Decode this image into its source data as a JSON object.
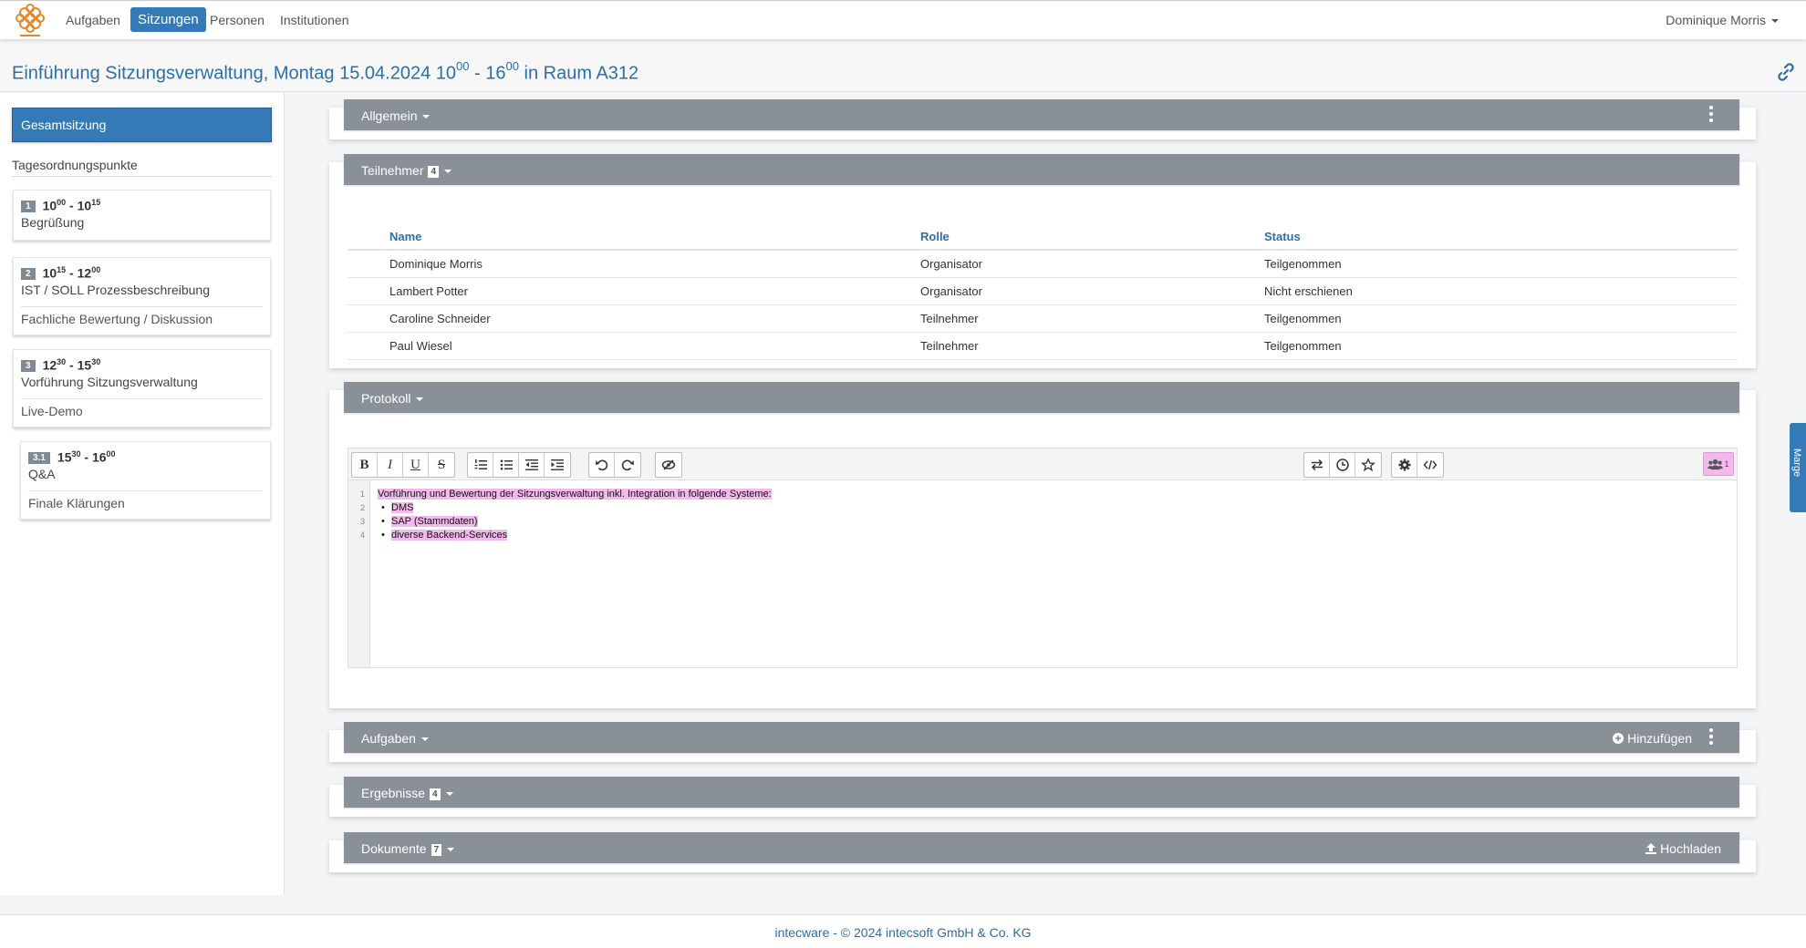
{
  "nav": {
    "items": [
      {
        "label": "Aufgaben",
        "active": false
      },
      {
        "label": "Sitzungen",
        "active": true
      },
      {
        "label": "Personen",
        "active": false
      },
      {
        "label": "Institutionen",
        "active": false
      }
    ],
    "user": "Dominique Morris",
    "logo_icon": "intecsoft-logo"
  },
  "title": {
    "prefix": "Einführung Sitzungsverwaltung, Montag 15.04.2024 10",
    "start_min": "00",
    "sep": " - 16",
    "end_min": "00",
    "suffix": " in Raum A312",
    "link_icon": "link-icon"
  },
  "sidebar": {
    "gesamt_label": "Gesamtsitzung",
    "agenda_heading": "Tagesordnungspunkte",
    "items": [
      {
        "num": "1",
        "start_h": "10",
        "start_m": "00",
        "end_h": "10",
        "end_m": "15",
        "title": "Begrüßung",
        "sub": ""
      },
      {
        "num": "2",
        "start_h": "10",
        "start_m": "15",
        "end_h": "12",
        "end_m": "00",
        "title": "IST / SOLL Prozessbeschreibung",
        "sub": "Fachliche Bewertung / Diskussion"
      },
      {
        "num": "3",
        "start_h": "12",
        "start_m": "30",
        "end_h": "15",
        "end_m": "30",
        "title": "Vorführung Sitzungsverwaltung",
        "sub": "Live-Demo"
      },
      {
        "num": "3.1",
        "start_h": "15",
        "start_m": "30",
        "end_h": "16",
        "end_m": "00",
        "title": "Q&A",
        "sub": "Finale Klärungen"
      }
    ]
  },
  "panels": {
    "allgemein": {
      "label": "Allgemein"
    },
    "teilnehmer": {
      "label": "Teilnehmer",
      "count": "4",
      "columns": [
        "Name",
        "Rolle",
        "Status"
      ],
      "rows": [
        [
          "Dominique Morris",
          "Organisator",
          "Teilgenommen"
        ],
        [
          "Lambert Potter",
          "Organisator",
          "Nicht erschienen"
        ],
        [
          "Caroline Schneider",
          "Teilnehmer",
          "Teilgenommen"
        ],
        [
          "Paul Wiesel",
          "Teilnehmer",
          "Teilgenommen"
        ]
      ]
    },
    "protokoll": {
      "label": "Protokoll",
      "toolbar": {
        "bold": "B",
        "italic": "I",
        "underline": "U",
        "strike": "S",
        "collab_count": "1"
      },
      "line_numbers": [
        "1",
        "2",
        "3",
        "4"
      ],
      "lines": [
        "Vorführung und Bewertung der Sitzungsverwaltung inkl. Integration in folgende Systeme:",
        "DMS",
        "SAP (Stammdaten)",
        "diverse Backend-Services"
      ],
      "highlight_color": "#f3b8ec"
    },
    "aufgaben": {
      "label": "Aufgaben",
      "action": "Hinzufügen"
    },
    "ergebnisse": {
      "label": "Ergebnisse",
      "count": "4"
    },
    "dokumente": {
      "label": "Dokumente",
      "count": "7",
      "action": "Hochladen"
    }
  },
  "side_tab": "Marge",
  "footer": "intecware - © 2024 intecsoft GmbH & Co. KG",
  "colors": {
    "primary": "#337ab7",
    "panel_header": "#8a9098",
    "title": "#2a6eab"
  }
}
